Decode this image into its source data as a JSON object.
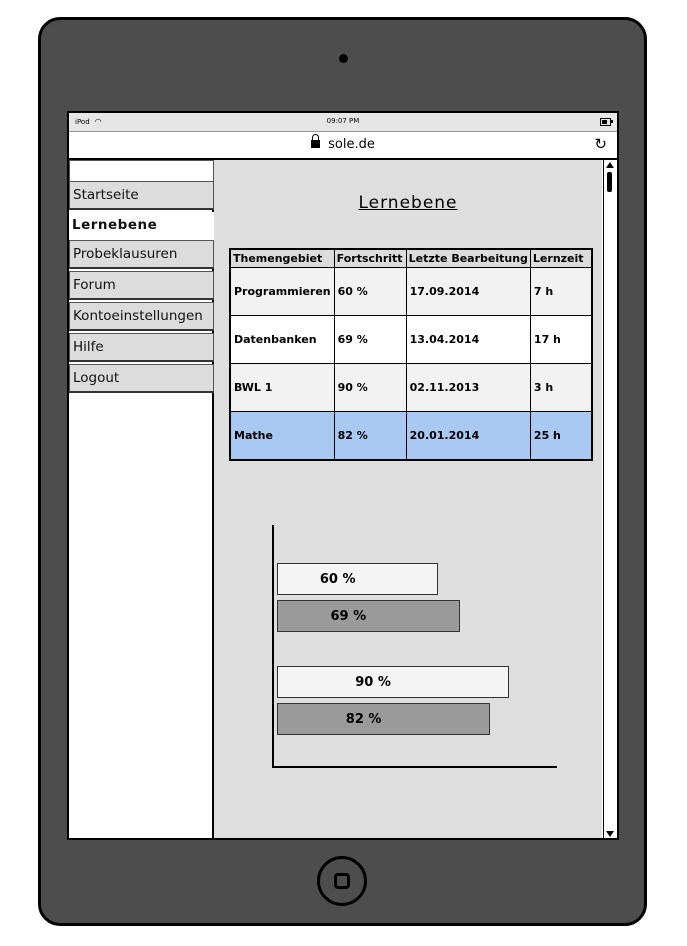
{
  "statusbar": {
    "device": "iPod",
    "time": "09:07 PM"
  },
  "browser": {
    "url": "sole.de"
  },
  "sidebar": {
    "items": [
      {
        "label": "Startseite"
      },
      {
        "label": "Lernebene"
      },
      {
        "label": "Probeklausuren"
      },
      {
        "label": "Forum"
      },
      {
        "label": "Kontoeinstellungen"
      },
      {
        "label": "Hilfe"
      },
      {
        "label": "Logout"
      }
    ],
    "active": "Lernebene"
  },
  "main": {
    "title": "Lernebene",
    "table": {
      "headers": [
        "Themengebiet",
        "Fortschritt",
        "Letzte Bearbeitung",
        "Lernzeit"
      ],
      "rows": [
        [
          "Programmieren",
          "60 %",
          "17.09.2014",
          "7 h"
        ],
        [
          "Datenbanken",
          "69 %",
          "13.04.2014",
          "17 h"
        ],
        [
          "BWL 1",
          "90 %",
          "02.11.2013",
          "3 h"
        ],
        [
          "Mathe",
          "82 %",
          "20.01.2014",
          "25 h"
        ]
      ],
      "selected_row": 3
    }
  },
  "chart_data": {
    "type": "bar",
    "orientation": "horizontal",
    "values": [
      60,
      69,
      90,
      82
    ],
    "labels": [
      "60 %",
      "69 %",
      "90 %",
      "82 %"
    ],
    "colors": [
      "#f4f4f4",
      "#9a9a9a",
      "#f4f4f4",
      "#9a9a9a"
    ],
    "xlim": [
      0,
      100
    ]
  },
  "colors": {
    "selected_row": "#a9c8f2",
    "device": "#4d4d4d",
    "content_bg": "#dedede"
  }
}
